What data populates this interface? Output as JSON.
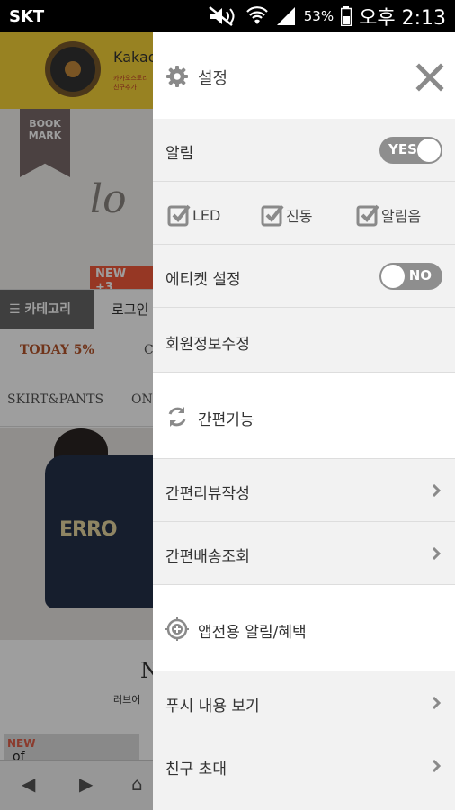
{
  "status_bar": {
    "carrier": "SKT",
    "battery": "53%",
    "time": "오후 2:13"
  },
  "background": {
    "brand": "Kakao",
    "brand_sub": "카카오스토리 친구추가",
    "bookmark": "BOOK MARK",
    "script_text": "lo",
    "new_badge": "NEW +3",
    "category_button": "☰ 카테고리",
    "login_text": "로그인",
    "today": "TODAY 5%",
    "today_next": "C",
    "skirt": "SKIRT&PANTS",
    "skirt_next": "ON",
    "shirt_text": "ERRO",
    "n_letter": "N",
    "love_text": "러브어",
    "thumb_new": "NEW",
    "thumb_of": "of"
  },
  "drawer": {
    "title": "설정",
    "notification": {
      "label": "알림",
      "toggle": "YES",
      "on": true
    },
    "checkboxes": [
      {
        "label": "LED",
        "checked": true
      },
      {
        "label": "진동",
        "checked": true
      },
      {
        "label": "알림음",
        "checked": true
      }
    ],
    "etiquette": {
      "label": "에티켓 설정",
      "toggle": "NO",
      "on": false
    },
    "member_edit": "회원정보수정",
    "section_easy": "간편기능",
    "easy_review": "간편리뷰작성",
    "easy_delivery": "간편배송조회",
    "section_app": "앱전용 알림/혜택",
    "push_view": "푸시 내용 보기",
    "invite": "친구 초대"
  },
  "colors": {
    "drawer_bg": "#f2f2f2",
    "toggle_bg": "#8e8e8e",
    "icon_gray": "#8a8a8a"
  }
}
